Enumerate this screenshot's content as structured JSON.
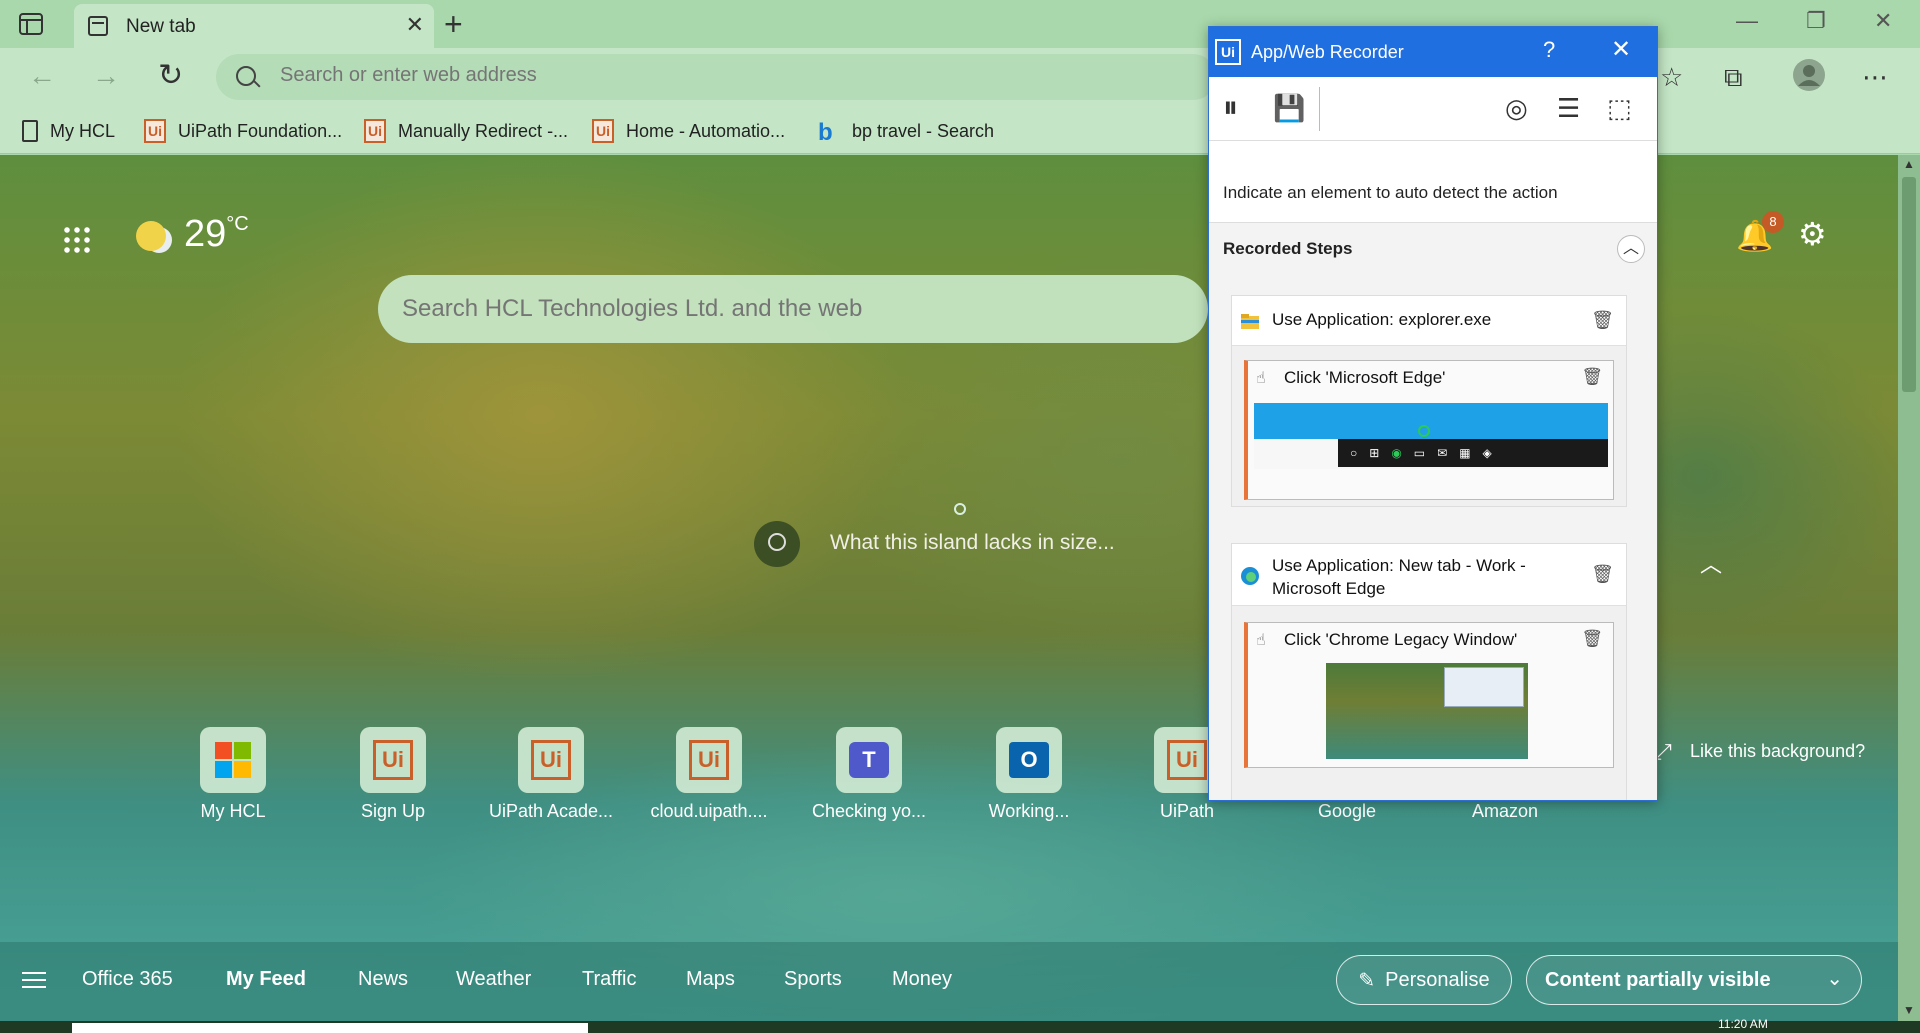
{
  "browser": {
    "tab_title": "New tab",
    "address_placeholder": "Search or enter web address",
    "favorites": [
      {
        "label": "My HCL",
        "icon": "page-icon"
      },
      {
        "label": "UiPath Foundation...",
        "icon": "uipath-icon"
      },
      {
        "label": "Manually Redirect -...",
        "icon": "uipath-icon"
      },
      {
        "label": "Home - Automatio...",
        "icon": "uipath-icon"
      },
      {
        "label": "bp travel - Search",
        "icon": "bing-icon"
      }
    ]
  },
  "newtab": {
    "temperature": "29",
    "temp_unit": "°C",
    "notification_count": "8",
    "search_placeholder": "Search HCL Technologies Ltd. and the web",
    "bg_caption": "What this island lacks in size...",
    "tiles": [
      {
        "label": "My HCL",
        "icon": "microsoft-icon"
      },
      {
        "label": "Sign Up",
        "icon": "uipath-icon"
      },
      {
        "label": "UiPath Acade...",
        "icon": "uipath-icon"
      },
      {
        "label": "cloud.uipath....",
        "icon": "uipath-icon"
      },
      {
        "label": "Checking yo...",
        "icon": "teams-icon"
      },
      {
        "label": "Working...",
        "icon": "outlook-icon"
      },
      {
        "label": "UiPath",
        "icon": "uipath-icon"
      },
      {
        "label": "Google",
        "icon": "google-icon"
      },
      {
        "label": "Amazon",
        "icon": "amazon-icon"
      }
    ],
    "like_bg": "Like this background?",
    "feed_tabs": [
      "Office 365",
      "My Feed",
      "News",
      "Weather",
      "Traffic",
      "Maps",
      "Sports",
      "Money"
    ],
    "personalise": "Personalise",
    "visibility": "Content partially visible",
    "clock": "11:20 AM"
  },
  "recorder": {
    "logo": "Ui",
    "title": "App/Web Recorder",
    "help": "?",
    "instruction": "Indicate an element to auto detect the action",
    "steps_title": "Recorded Steps",
    "apps": [
      {
        "title": "Use Application: explorer.exe",
        "step": "Click 'Microsoft Edge'"
      },
      {
        "title": "Use Application: New tab - Work - Microsoft Edge",
        "step": "Click 'Chrome Legacy Window'"
      }
    ]
  },
  "colors": {
    "accent": "#1f6fe0",
    "step_accent": "#e8743a",
    "uipath": "#c9602a"
  }
}
